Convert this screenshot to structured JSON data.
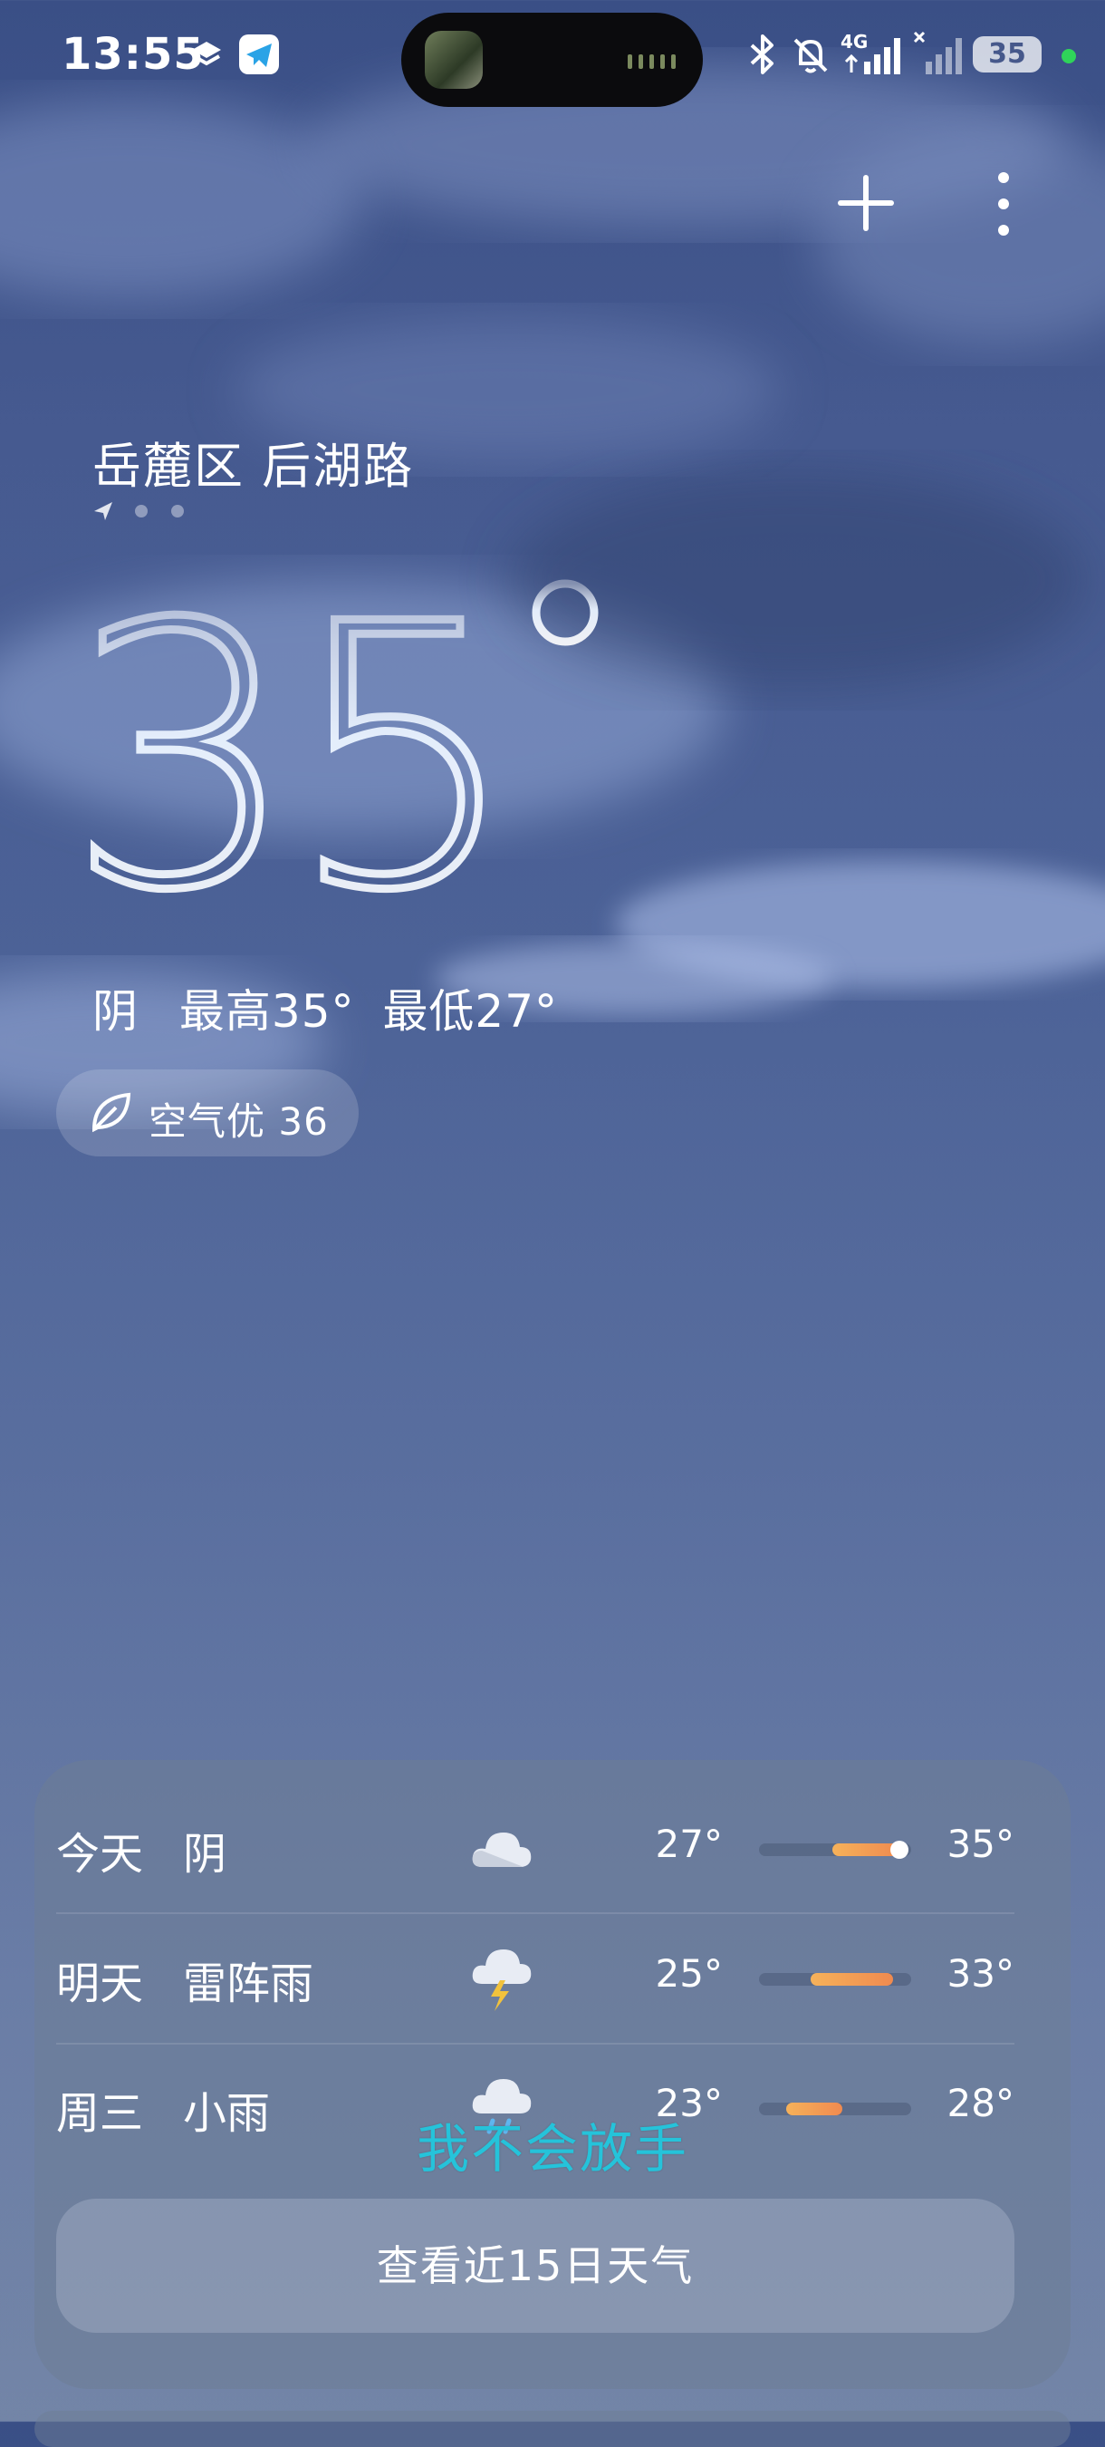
{
  "status_bar": {
    "time": "13:55",
    "network": "4G",
    "battery": "35"
  },
  "location": "岳麓区 后湖路",
  "temperature": "35",
  "degree_symbol": "°",
  "summary": {
    "condition": "阴",
    "high": "最高35°",
    "low": "最低27°"
  },
  "air_quality": "空气优 36",
  "forecast": [
    {
      "day": "今天",
      "condition": "阴",
      "low": "27°",
      "high": "35°",
      "icon": "cloudy-icon",
      "bar_start": 0.48,
      "bar_end": 0.92,
      "current_marker": 0.92
    },
    {
      "day": "明天",
      "condition": "雷阵雨",
      "low": "25°",
      "high": "33°",
      "icon": "thunderstorm-icon",
      "bar_start": 0.34,
      "bar_end": 0.88
    },
    {
      "day": "周三",
      "condition": "小雨",
      "low": "23°",
      "high": "28°",
      "icon": "light-rain-icon",
      "bar_start": 0.18,
      "bar_end": 0.55
    }
  ],
  "forecast_button": "查看近15日天气",
  "overlay_caption": "我不会放手",
  "colors": {
    "bar_gradient_start": "#f6b25a",
    "bar_gradient_end": "#f08a4f",
    "overlay_text": "#25c3da"
  }
}
